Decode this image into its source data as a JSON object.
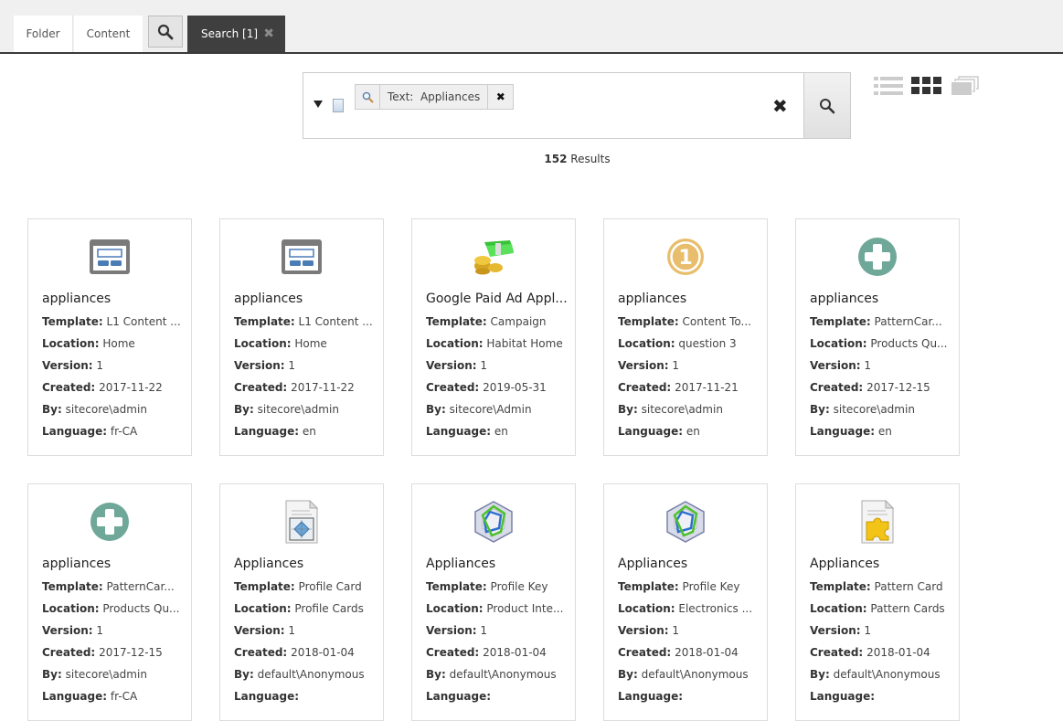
{
  "tabs": [
    {
      "label": "Folder"
    },
    {
      "label": "Content"
    },
    {
      "label": "Search [1]",
      "active": true
    }
  ],
  "search": {
    "chip_prefix": "Text:",
    "chip_value": "Appliances",
    "chip_label": "Text:  Appliances"
  },
  "results": {
    "count": "152",
    "label": "Results"
  },
  "field_labels": {
    "template": "Template:",
    "location": "Location:",
    "version": "Version:",
    "created": "Created:",
    "by": "By:",
    "language": "Language:"
  },
  "cards": [
    {
      "icon": "layout-icon",
      "title": "appliances",
      "template": "L1 Content ...",
      "location": "Home",
      "version": "1",
      "created": "2017-11-22",
      "by": "sitecore\\admin",
      "language": "fr-CA"
    },
    {
      "icon": "layout-icon",
      "title": "appliances",
      "template": "L1 Content ...",
      "location": "Home",
      "version": "1",
      "created": "2017-11-22",
      "by": "sitecore\\admin",
      "language": "en"
    },
    {
      "icon": "campaign-money-icon",
      "title": "Google Paid Ad Appl...",
      "template": "Campaign",
      "location": "Habitat Home",
      "version": "1",
      "created": "2019-05-31",
      "by": "sitecore\\Admin",
      "language": "en"
    },
    {
      "icon": "number-one-icon",
      "title": "appliances",
      "template": "Content To...",
      "location": "question 3",
      "version": "1",
      "created": "2017-11-21",
      "by": "sitecore\\admin",
      "language": "en"
    },
    {
      "icon": "plus-circle-icon",
      "title": "appliances",
      "template": "PatternCar...",
      "location": "Products Qu...",
      "version": "1",
      "created": "2017-12-15",
      "by": "sitecore\\admin",
      "language": "en"
    },
    {
      "icon": "plus-circle-icon",
      "title": "appliances",
      "template": "PatternCar...",
      "location": "Products Qu...",
      "version": "1",
      "created": "2017-12-15",
      "by": "sitecore\\admin",
      "language": "fr-CA"
    },
    {
      "icon": "profile-card-icon",
      "title": "Appliances",
      "template": "Profile Card",
      "location": "Profile Cards",
      "version": "1",
      "created": "2018-01-04",
      "by": "default\\Anonymous",
      "language": ""
    },
    {
      "icon": "profile-key-icon",
      "title": "Appliances",
      "template": "Profile Key",
      "location": "Product Inte...",
      "version": "1",
      "created": "2018-01-04",
      "by": "default\\Anonymous",
      "language": ""
    },
    {
      "icon": "profile-key-icon",
      "title": "Appliances",
      "template": "Profile Key",
      "location": "Electronics ...",
      "version": "1",
      "created": "2018-01-04",
      "by": "default\\Anonymous",
      "language": ""
    },
    {
      "icon": "pattern-card-icon",
      "title": "Appliances",
      "template": "Pattern Card",
      "location": "Pattern Cards",
      "version": "1",
      "created": "2018-01-04",
      "by": "default\\Anonymous",
      "language": ""
    }
  ]
}
